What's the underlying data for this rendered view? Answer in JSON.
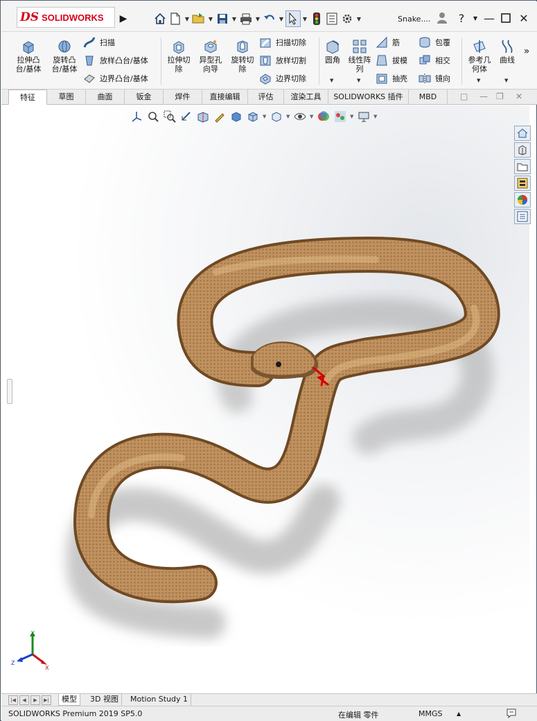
{
  "app": {
    "logo_mark": "DS",
    "logo_text": "SOLIDWORKS",
    "document_title": "Snake....",
    "icons": [
      "home-icon",
      "new-document-icon",
      "open-folder-icon",
      "save-icon",
      "print-icon",
      "undo-icon",
      "select-arrow-icon",
      "traffic-light-icon",
      "file-properties-icon",
      "settings-gear-icon",
      "user-icon",
      "help-icon",
      "minimize-icon",
      "maximize-icon",
      "close-icon"
    ]
  },
  "ribbon": {
    "extrude_boss": "拉伸凸\n台/基体",
    "revolve_boss": "旋转凸\n台/基体",
    "sweep": "扫描",
    "loft_boss": "放样凸台/基体",
    "boundary_boss": "边界凸台/基体",
    "extrude_cut": "拉伸切\n除",
    "hole_wizard": "异型孔\n向导",
    "revolve_cut": "旋转切\n除",
    "swept_cut": "扫描切除",
    "lofted_cut": "放样切割",
    "boundary_cut": "边界切除",
    "fillet": "圆角",
    "linear_pattern": "线性阵\n列",
    "rib": "筋",
    "draft": "拔模",
    "shell": "抽壳",
    "wrap": "包覆",
    "intersect": "相交",
    "mirror": "镜向",
    "reference_geometry": "参考几\n何体",
    "curves": "曲线",
    "more": "»"
  },
  "tabs": [
    "特征",
    "草图",
    "曲面",
    "钣金",
    "焊件",
    "直接编辑",
    "评估",
    "渲染工具",
    "SOLIDWORKS 插件",
    "MBD"
  ],
  "active_tab": "特征",
  "viewport": {
    "model_description": "snake",
    "colors": {
      "snake_body": "#b98a52",
      "snake_dark": "#7a5530",
      "tongue": "#d40000"
    },
    "triad": {
      "x": "X",
      "y": "Y",
      "z": "Z"
    }
  },
  "bottom_tabs": [
    "模型",
    "3D 视图",
    "Motion Study 1"
  ],
  "active_bottom_tab": "模型",
  "status": {
    "version": "SOLIDWORKS Premium 2019 SP5.0",
    "mode": "在编辑 零件",
    "units": "MMGS",
    "units_caret": "▲"
  }
}
